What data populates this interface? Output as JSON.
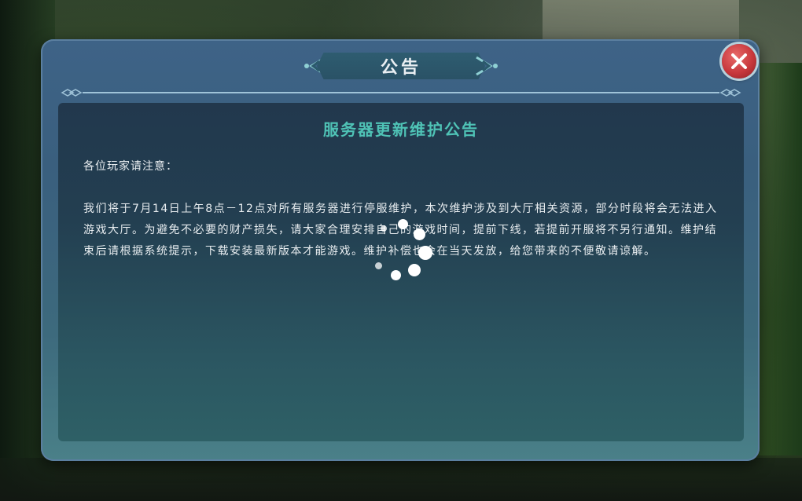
{
  "dialog": {
    "title": "公告",
    "close_icon": "close-x-icon"
  },
  "notice": {
    "heading": "服务器更新维护公告",
    "greeting": "各位玩家请注意：",
    "body": "我们将于7月14日上午8点－12点对所有服务器进行停服维护，本次维护涉及到大厅相关资源，部分时段将会无法进入游戏大厅。为避免不必要的财产损失，请大家合理安排自己的游戏时间，提前下线，若提前开服将不另行通知。维护结束后请根据系统提示，下载安装最新版本才能游戏。维护补偿也会在当天发放，给您带来的不便敬请谅解。"
  },
  "loading": {
    "icon": "loading-spinner-icon"
  },
  "colors": {
    "heading": "#4fc3b6",
    "panel": "#22384d",
    "close_button": "#c8383c"
  }
}
